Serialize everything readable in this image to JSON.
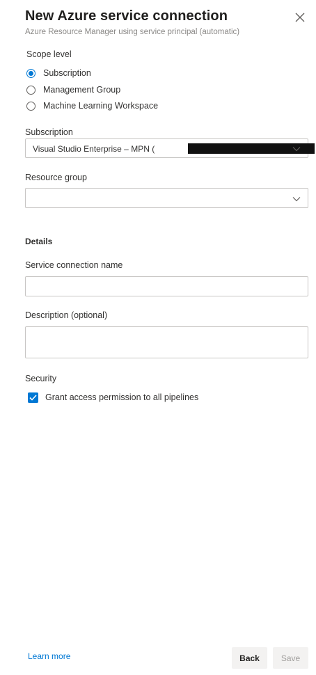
{
  "dialog": {
    "title": "New Azure service connection",
    "subtitle": "Azure Resource Manager using service principal (automatic)"
  },
  "scope": {
    "label": "Scope level",
    "options": [
      {
        "label": "Subscription",
        "selected": true
      },
      {
        "label": "Management Group",
        "selected": false
      },
      {
        "label": "Machine Learning Workspace",
        "selected": false
      }
    ]
  },
  "subscription": {
    "label": "Subscription",
    "value": "Visual Studio Enterprise – MPN ("
  },
  "resource_group": {
    "label": "Resource group",
    "value": ""
  },
  "details": {
    "heading": "Details",
    "name_label": "Service connection name",
    "name_value": "",
    "description_label": "Description (optional)",
    "description_value": ""
  },
  "security": {
    "label": "Security",
    "grant_access_label": "Grant access permission to all pipelines",
    "grant_access_checked": true
  },
  "footer": {
    "learn_more": "Learn more",
    "back_label": "Back",
    "save_label": "Save"
  },
  "colors": {
    "accent": "#0078d4",
    "border": "#c8c6c4",
    "muted_text": "#8a8886",
    "disabled_text": "#a19f9d"
  }
}
